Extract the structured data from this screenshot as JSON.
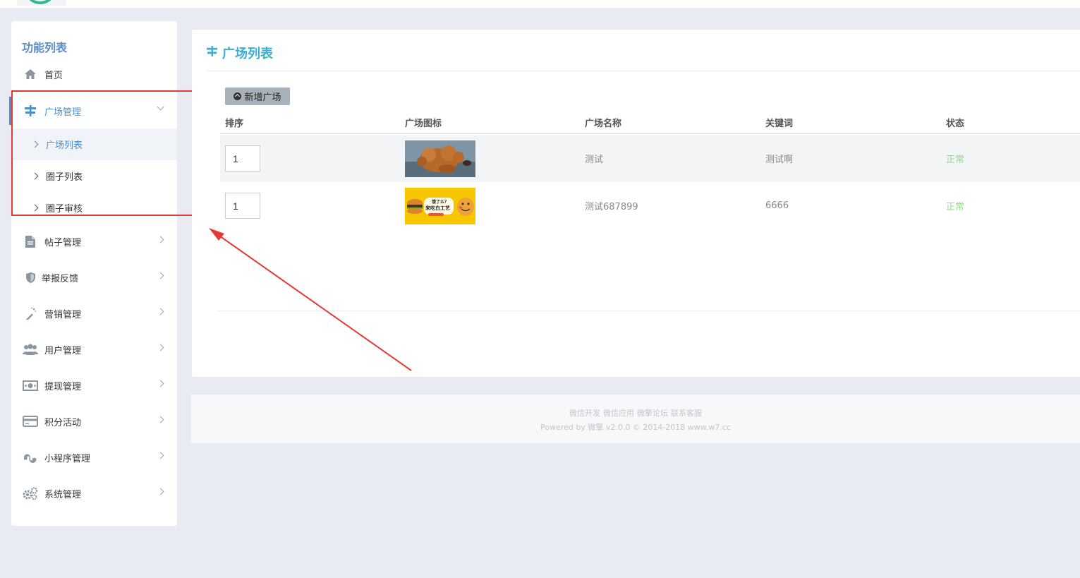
{
  "sidebar": {
    "title": "功能列表",
    "items": [
      {
        "label": "首页",
        "icon": "home-icon"
      },
      {
        "label": "广场管理",
        "icon": "signpost-icon",
        "open": true,
        "children": [
          {
            "label": "广场列表",
            "current": true
          },
          {
            "label": "圈子列表"
          },
          {
            "label": "圈子审核"
          }
        ]
      },
      {
        "label": "帖子管理",
        "icon": "document-icon"
      },
      {
        "label": "举报反馈",
        "icon": "shield-icon"
      },
      {
        "label": "营销管理",
        "icon": "magic-wand-icon"
      },
      {
        "label": "用户管理",
        "icon": "users-icon"
      },
      {
        "label": "提现管理",
        "icon": "money-icon"
      },
      {
        "label": "积分活动",
        "icon": "credit-card-icon"
      },
      {
        "label": "小程序管理",
        "icon": "stumbleupon-icon"
      },
      {
        "label": "系统管理",
        "icon": "gears-icon"
      }
    ]
  },
  "main": {
    "title": "广场列表",
    "add_button": "新增广场",
    "columns": [
      "排序",
      "广场图标",
      "广场名称",
      "关键词",
      "状态"
    ],
    "rows": [
      {
        "sort": "1",
        "image": "dog-photo",
        "name": "测试",
        "keyword": "测试啊",
        "status": "正常"
      },
      {
        "sort": "1",
        "image": "burger-cartoon",
        "name": "测试687899",
        "keyword": "6666",
        "status": "正常"
      }
    ],
    "thumb_texts": [
      "饿了么？",
      "来吃白工艺"
    ]
  },
  "footer": {
    "links": [
      "微信开发",
      "微信应用",
      "微擎论坛",
      "联系客服"
    ],
    "copyright": "Powered by 微擎 v2.0.0 © 2014-2018 www.w7.cc"
  },
  "colors": {
    "accent": "#3aafd0",
    "sidebar_active": "#4a8fcf",
    "status_ok": "#8fdc8f",
    "annotation": "#e53935"
  }
}
